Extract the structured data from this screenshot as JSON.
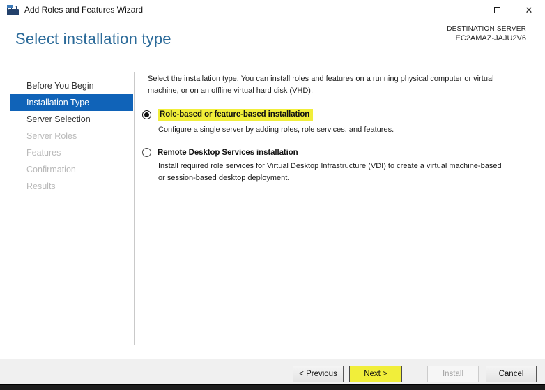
{
  "window": {
    "title": "Add Roles and Features Wizard",
    "icons": {
      "app": "server-manager-icon",
      "minimize": "minimize-icon",
      "maximize": "maximize-icon",
      "close": "close-icon"
    }
  },
  "header": {
    "title": "Select installation type",
    "destination_label": "DESTINATION SERVER",
    "destination_server": "EC2AMAZ-JAJU2V6"
  },
  "sidebar": {
    "items": [
      {
        "label": "Before You Begin",
        "state": "enabled"
      },
      {
        "label": "Installation Type",
        "state": "selected"
      },
      {
        "label": "Server Selection",
        "state": "enabled"
      },
      {
        "label": "Server Roles",
        "state": "disabled"
      },
      {
        "label": "Features",
        "state": "disabled"
      },
      {
        "label": "Confirmation",
        "state": "disabled"
      },
      {
        "label": "Results",
        "state": "disabled"
      }
    ]
  },
  "main": {
    "intro_lines": [
      "Select the installation type. You can install roles and features on a running physical computer or virtual",
      "machine, or on an offline virtual hard disk (VHD)."
    ],
    "options": [
      {
        "label": "Role-based or feature-based installation",
        "selected": true,
        "highlighted": true,
        "description_lines": [
          "Configure a single server by adding roles, role services, and features."
        ]
      },
      {
        "label": "Remote Desktop Services installation",
        "selected": false,
        "highlighted": false,
        "description_lines": [
          "Install required role services for Virtual Desktop Infrastructure (VDI) to create a virtual machine-based",
          "or session-based desktop deployment."
        ]
      }
    ]
  },
  "footer": {
    "buttons": [
      {
        "label": "< Previous",
        "state": "enabled",
        "highlighted": false
      },
      {
        "label": "Next >",
        "state": "enabled",
        "highlighted": true
      },
      {
        "label": "Install",
        "state": "disabled",
        "highlighted": false
      },
      {
        "label": "Cancel",
        "state": "enabled",
        "highlighted": false
      }
    ]
  },
  "colors": {
    "sidebar_selected_blue": "#1063b8",
    "title_blue": "#2b6a99",
    "highlight_yellow": "#f1ee3a",
    "footer_gray": "#f0f0f0"
  }
}
